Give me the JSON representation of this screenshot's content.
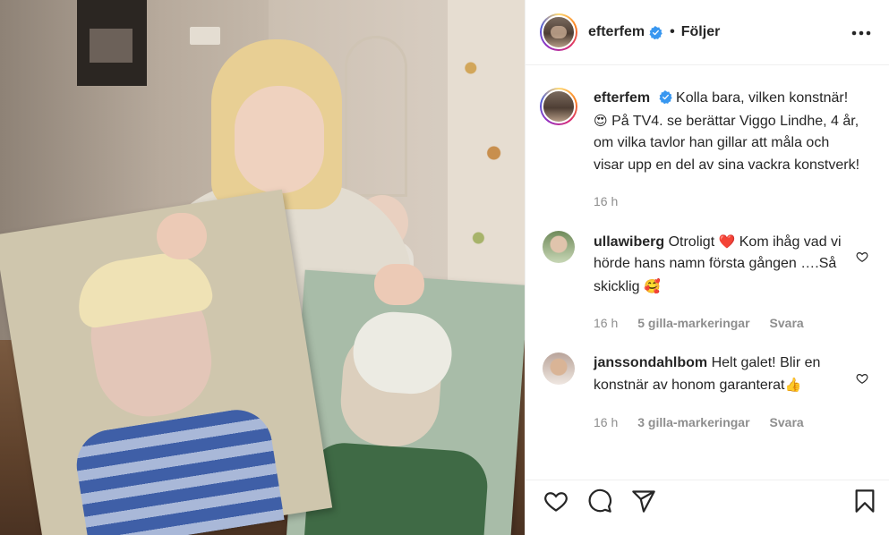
{
  "header": {
    "username": "efterfem",
    "separator": "•",
    "follow_label": "Följer"
  },
  "caption": {
    "username": "efterfem",
    "text_part1": "Kolla bara, vilken konstnär!",
    "emoji": "😍",
    "text_part2": "På TV4. se berättar Viggo Lindhe, 4 år, om vilka tavlor han gillar att måla och visar upp en del av sina vackra konstverk!",
    "time": "16 h"
  },
  "comments": [
    {
      "username": "ullawiberg",
      "text_part1": "Otroligt",
      "emoji1": "❤️",
      "text_part2": "Kom ihåg vad vi hörde hans namn första gången ….Så skicklig",
      "emoji2": "🥰",
      "time": "16 h",
      "likes": "5 gilla-markeringar",
      "reply_label": "Svara"
    },
    {
      "username": "janssondahlbom",
      "text_part1": "Helt galet! Blir en konstnär av honom garanterat",
      "emoji1": "👍",
      "time": "16 h",
      "likes": "3 gilla-markeringar",
      "reply_label": "Svara"
    }
  ],
  "icons": {
    "verified": "verified-badge-icon",
    "more": "more-options-icon",
    "like": "heart-icon",
    "comment": "comment-bubble-icon",
    "share": "paper-plane-icon",
    "save": "bookmark-icon"
  },
  "colors": {
    "verified": "#3897f0",
    "meta_text": "#8e8e8e",
    "text": "#262626",
    "heart_red": "#ed4956"
  }
}
